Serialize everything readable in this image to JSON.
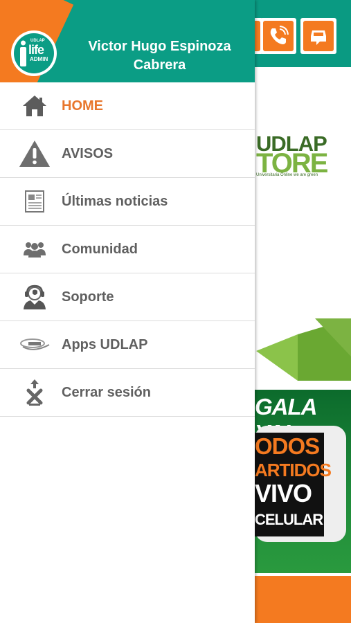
{
  "drawer": {
    "user_name": "Victor Hugo Espinoza Cabrera",
    "logo_text": {
      "top": "UDLAP",
      "main": "life",
      "sub": "ADMIN"
    },
    "items": [
      {
        "label": "HOME",
        "icon": "home-icon",
        "active": true
      },
      {
        "label": "AVISOS",
        "icon": "warning-icon",
        "active": false
      },
      {
        "label": "Últimas noticias",
        "icon": "newspaper-icon",
        "active": false
      },
      {
        "label": "Comunidad",
        "icon": "community-icon",
        "active": false
      },
      {
        "label": "Soporte",
        "icon": "support-agent-icon",
        "active": false
      },
      {
        "label": "Apps UDLAP",
        "icon": "apps-udlap-logo-icon",
        "active": false
      },
      {
        "label": "Cerrar sesión",
        "icon": "logout-icon",
        "active": false
      }
    ]
  },
  "background": {
    "store": {
      "line1": "UDLAP",
      "line2": "TORE",
      "line3": "Universitaria Online we are green"
    },
    "promo": {
      "headline": "GALA YA!",
      "lines": [
        "ODOS",
        "ARTIDOS",
        "VIVO",
        "CELULAR"
      ]
    }
  },
  "colors": {
    "header_green": "#0b9d85",
    "accent_orange": "#f47a20",
    "active_text": "#e8762c",
    "item_text": "#606060"
  }
}
